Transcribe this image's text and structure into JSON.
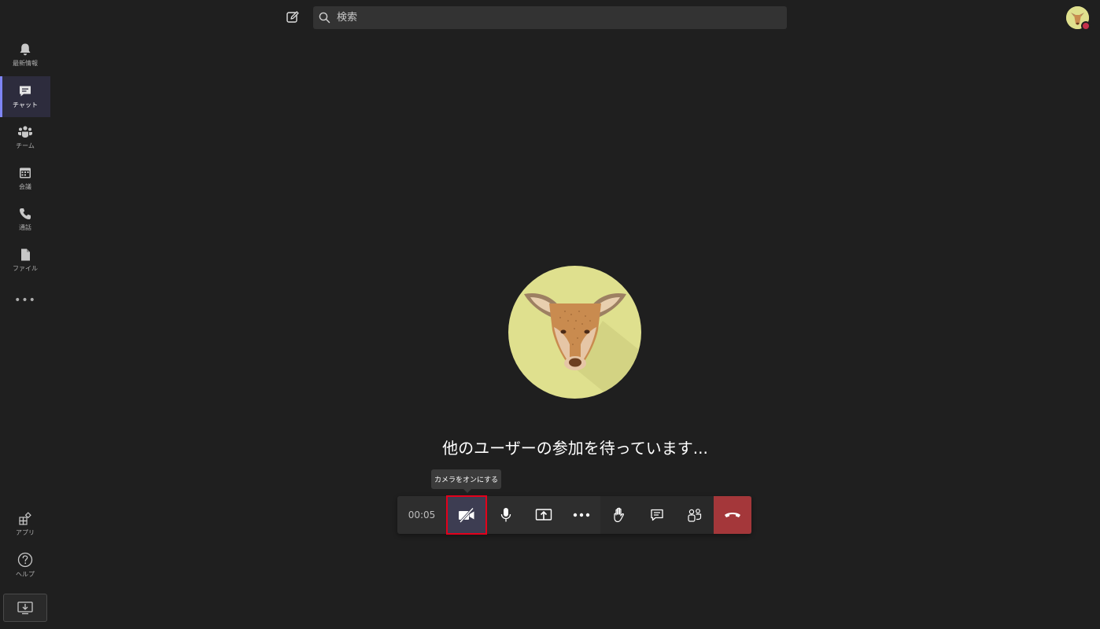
{
  "topbar": {
    "search_placeholder": "検索"
  },
  "rail": {
    "items": [
      {
        "label": "最新情報",
        "icon": "bell-icon"
      },
      {
        "label": "チャット",
        "icon": "chat-icon",
        "active": true
      },
      {
        "label": "チーム",
        "icon": "teams-icon"
      },
      {
        "label": "会議",
        "icon": "calendar-icon"
      },
      {
        "label": "通話",
        "icon": "phone-icon"
      },
      {
        "label": "ファイル",
        "icon": "file-icon"
      }
    ],
    "more_label": "•••",
    "bottom": [
      {
        "label": "アプリ",
        "icon": "apps-icon"
      },
      {
        "label": "ヘルプ",
        "icon": "help-icon"
      }
    ]
  },
  "stage": {
    "waiting_message": "他のユーザーの参加を待っています..."
  },
  "tooltip": {
    "text": "カメラをオンにする"
  },
  "callbar": {
    "timer": "00:05"
  },
  "colors": {
    "background": "#1f1f1f",
    "accent": "#7f85f5",
    "hangup": "#a4373a",
    "highlight": "#e3001b",
    "avatar_bg": "#dfe08e"
  }
}
